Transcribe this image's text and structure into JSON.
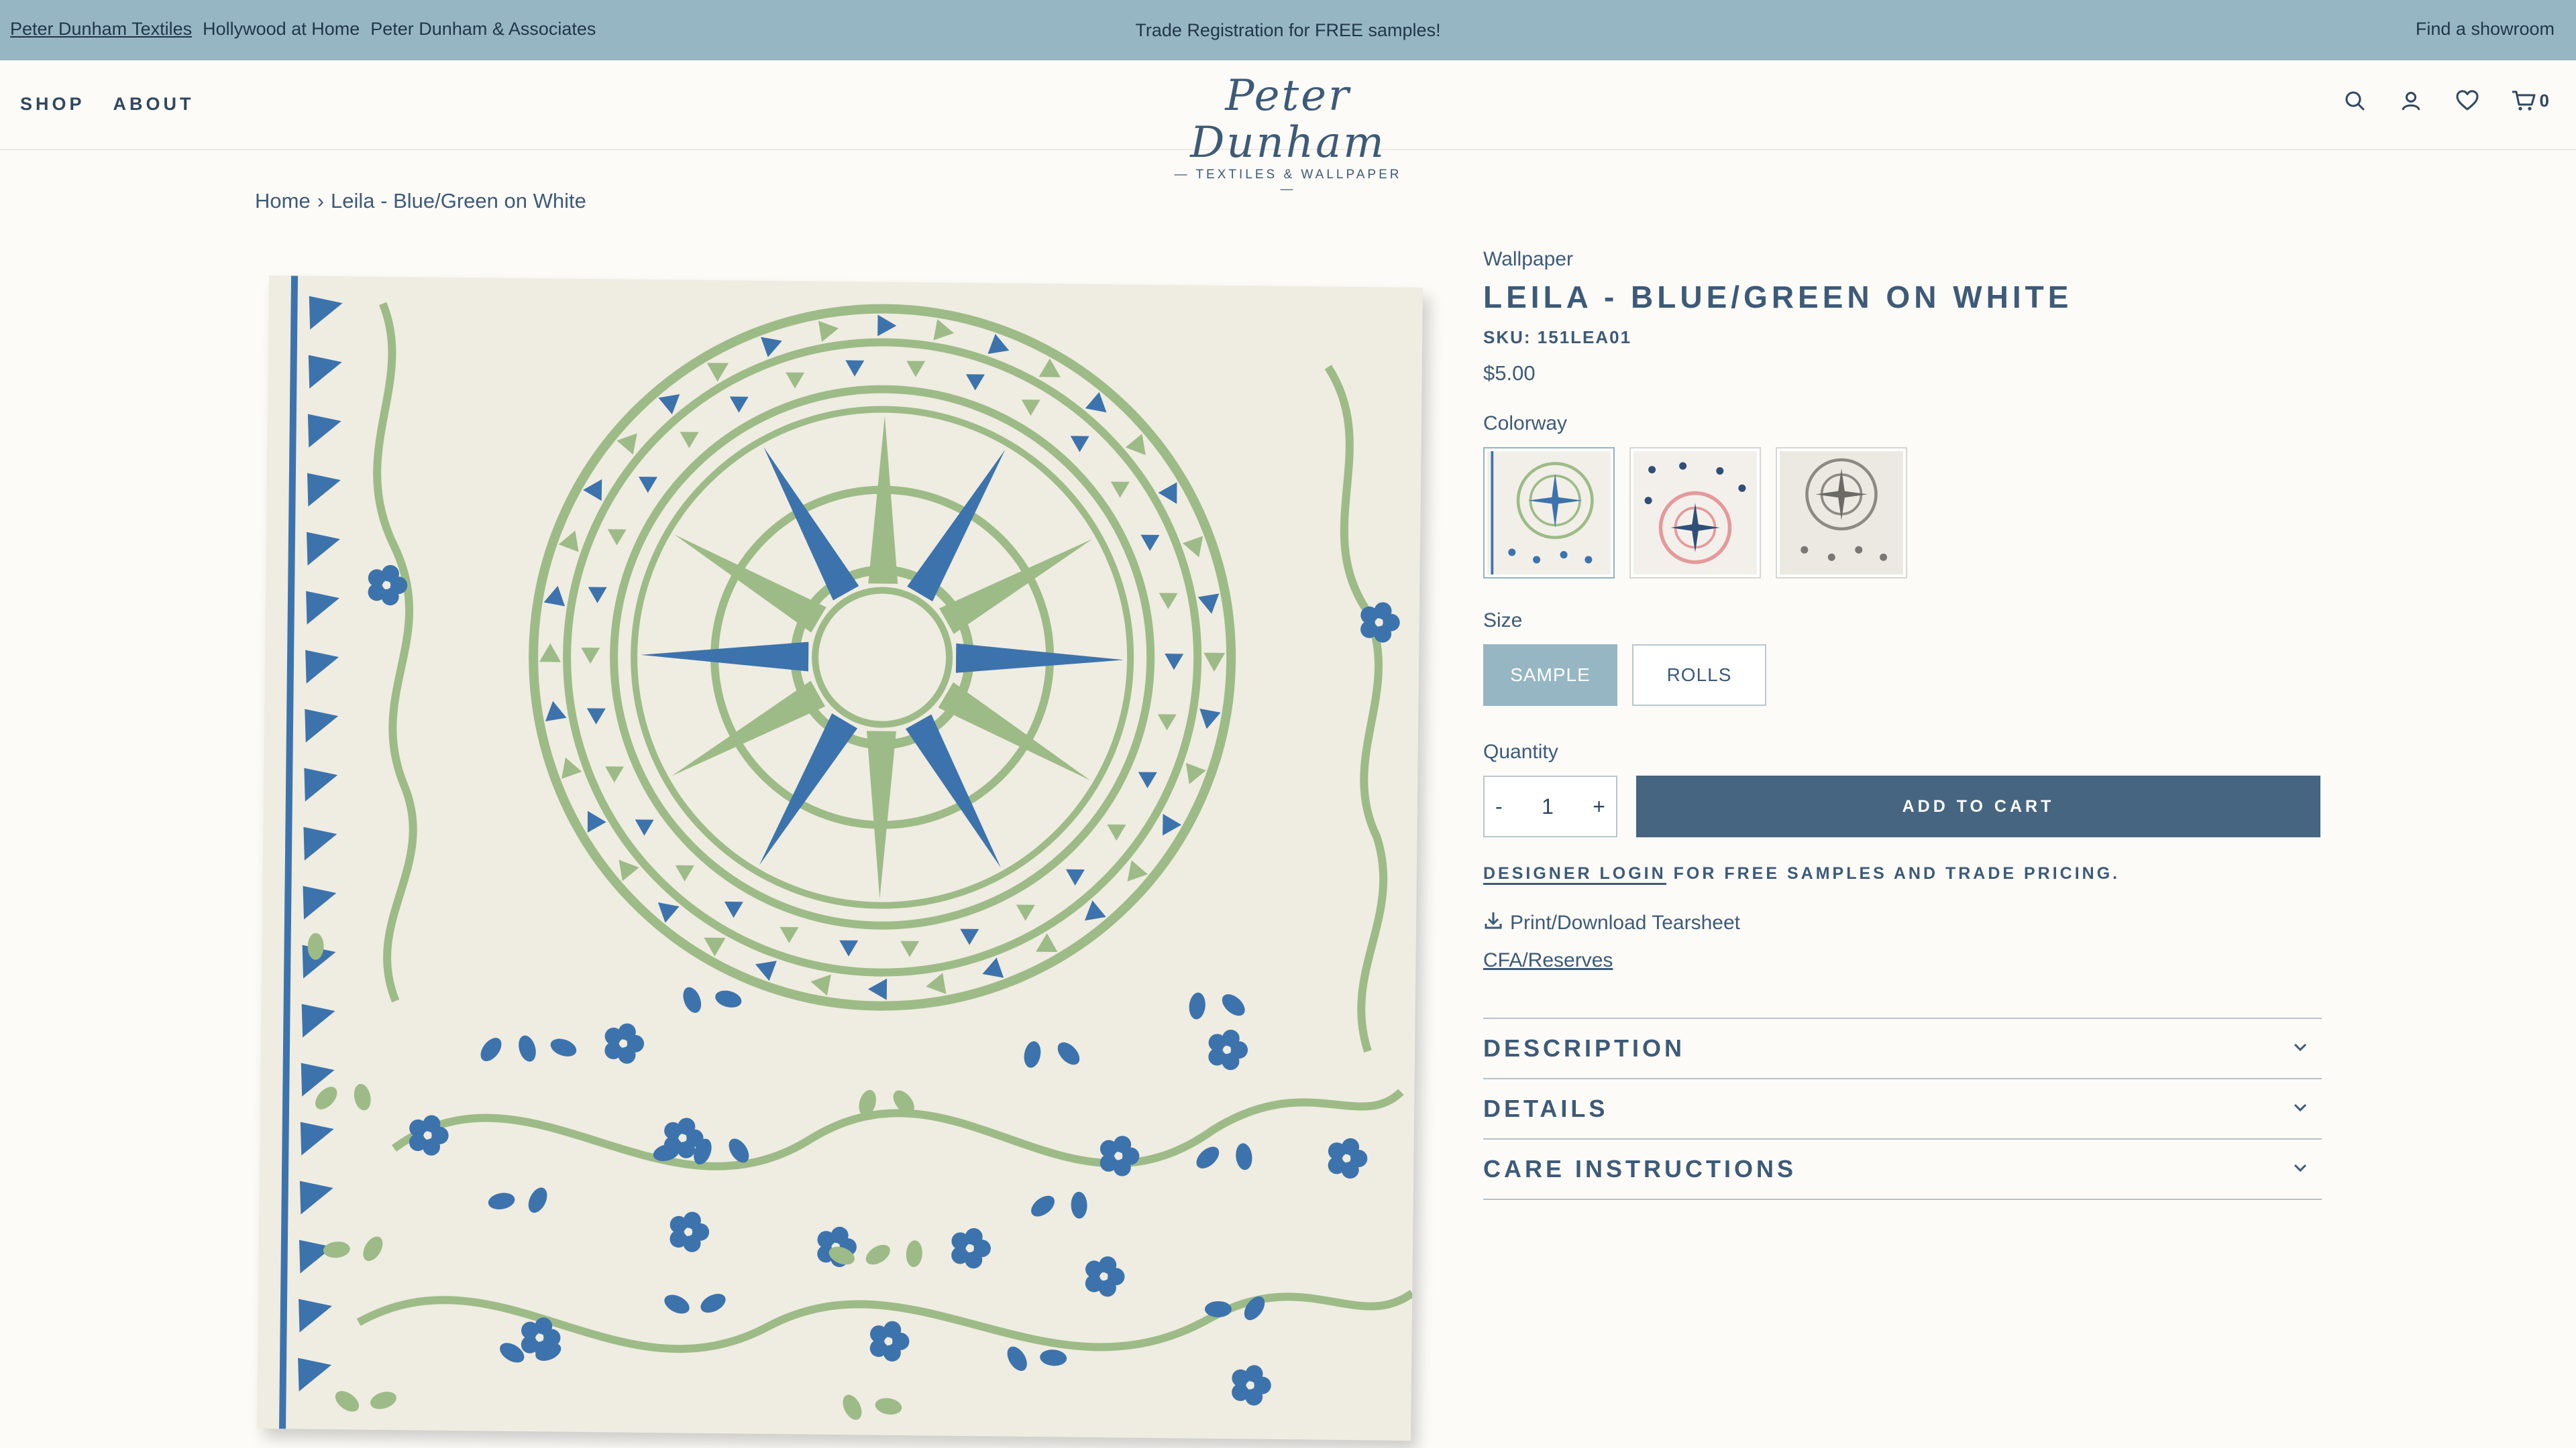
{
  "announcement": {
    "links": [
      "Peter Dunham Textiles",
      "Hollywood at Home",
      "Peter Dunham & Associates"
    ],
    "center_text": "Trade Registration for FREE samples!",
    "right_text": "Find a showroom"
  },
  "header": {
    "nav": [
      "SHOP",
      "ABOUT"
    ],
    "logo": {
      "word": "Peter Dunham",
      "sub": "— TEXTILES & WALLPAPER —"
    },
    "icons": [
      "search-icon",
      "account-icon",
      "wishlist-heart-icon",
      "cart-icon"
    ],
    "cart_count": "0"
  },
  "breadcrumb": {
    "home": "Home",
    "separator": "›",
    "current": "Leila - Blue/Green on White"
  },
  "product": {
    "vendor": "Wallpaper",
    "title": "LEILA - BLUE/GREEN ON WHITE",
    "sku": "SKU: 151LEA01",
    "price": "$5.00",
    "colorway_label": "Colorway",
    "colorways": [
      {
        "name": "Blue/Green on White",
        "selected": true
      },
      {
        "name": "Pink/Blue on White",
        "selected": false
      },
      {
        "name": "Grey on White",
        "selected": false
      }
    ],
    "size_label": "Size",
    "sizes": [
      {
        "label": "SAMPLE",
        "selected": true
      },
      {
        "label": "ROLLS",
        "selected": false
      }
    ],
    "quantity_label": "Quantity",
    "quantity": {
      "minus": "-",
      "value": "1",
      "plus": "+"
    },
    "add_to_cart": "ADD TO CART",
    "designer_login": "DESIGNER LOGIN",
    "designer_suffix": "FOR FREE SAMPLES AND TRADE PRICING.",
    "tearsheet": "Print/Download Tearsheet",
    "cfa": "CFA/Reserves",
    "accordion": [
      "DESCRIPTION",
      "DETAILS",
      "CARE INSTRUCTIONS"
    ]
  },
  "colors": {
    "topbar": "#96b6c3",
    "navy": "#3d5a78",
    "button": "#466581",
    "pattern_blue": "#3c73ad",
    "pattern_green": "#9dbb87"
  }
}
